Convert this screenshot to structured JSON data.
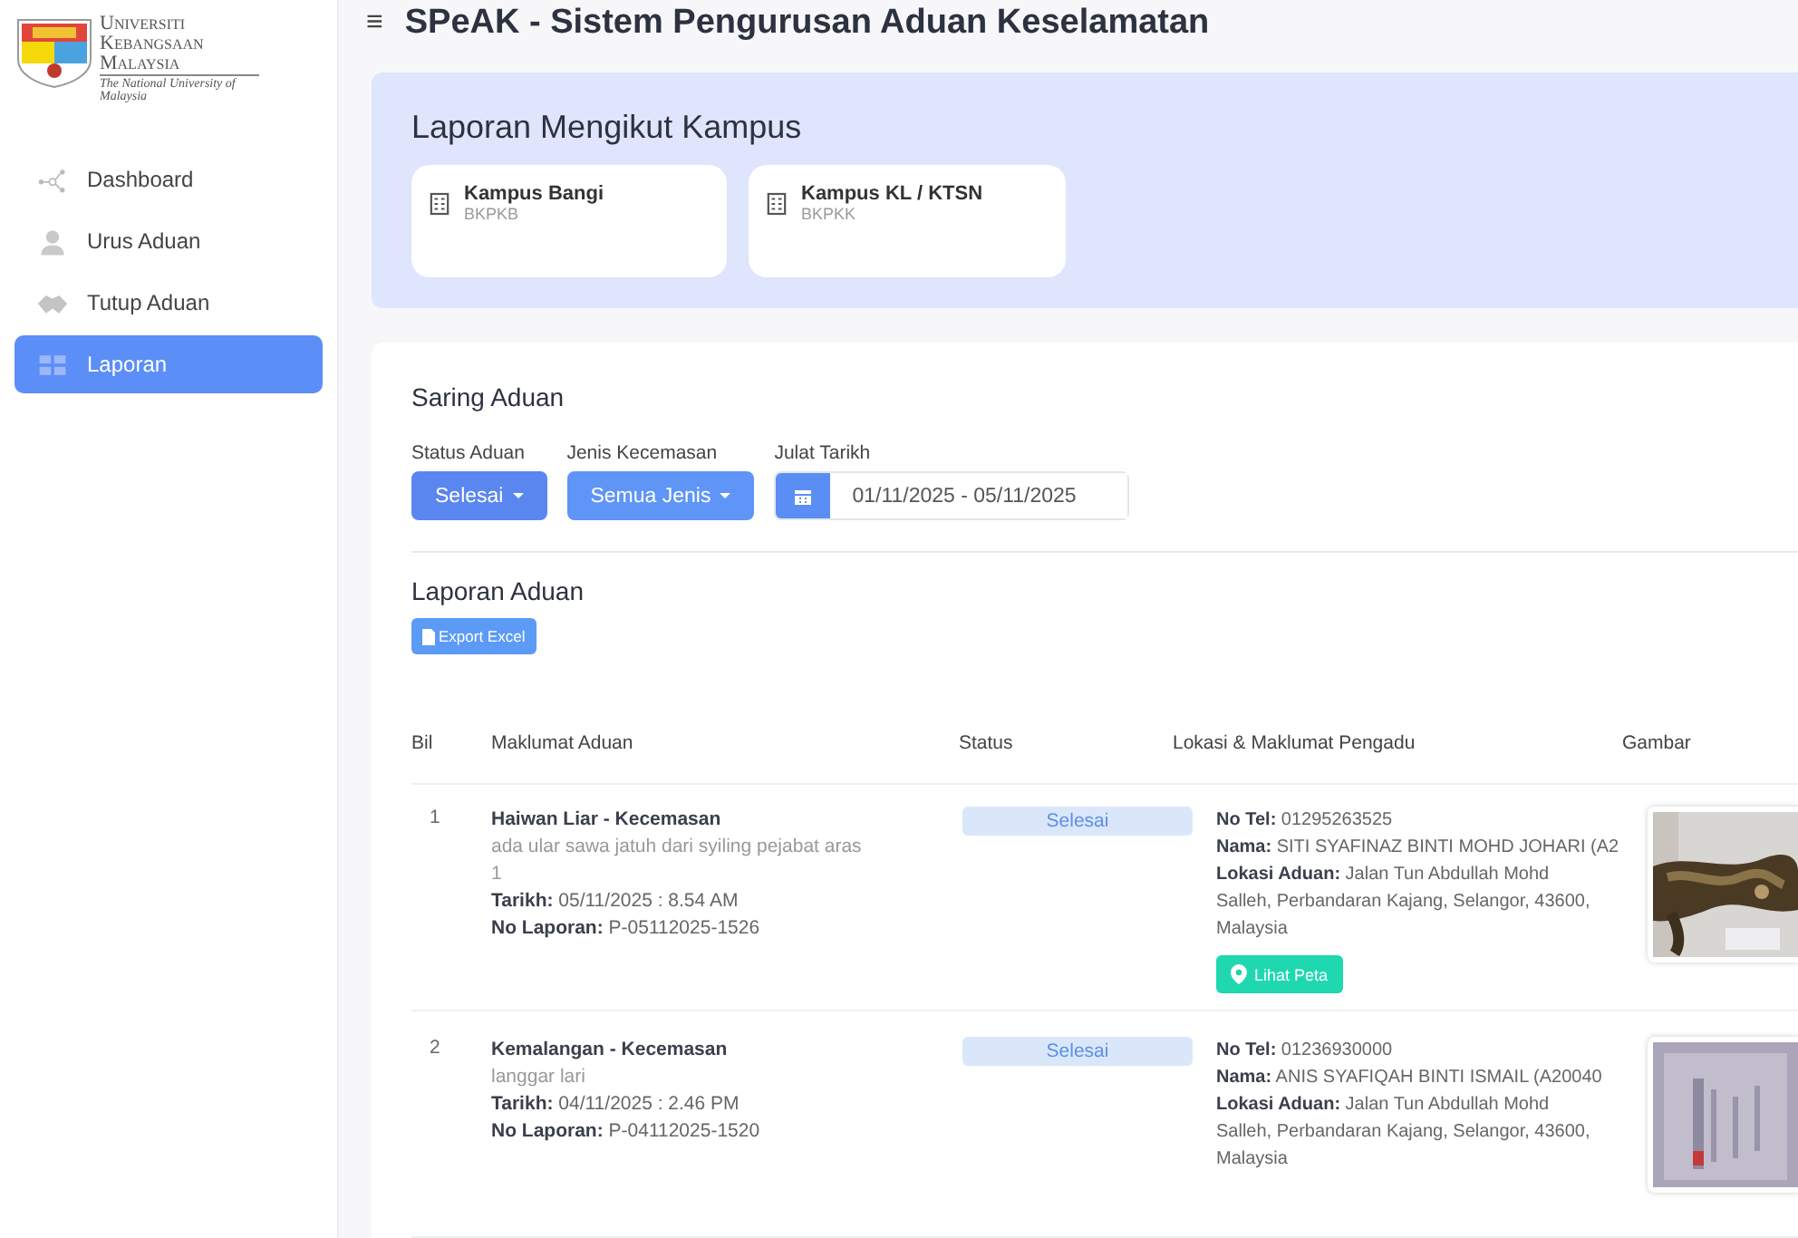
{
  "logo": {
    "name_lines": [
      "Universiti",
      "Kebangsaan",
      "Malaysia"
    ],
    "tagline": "The National University of Malaysia"
  },
  "sidebar": {
    "items": [
      {
        "label": "Dashboard",
        "selected": false
      },
      {
        "label": "Urus Aduan",
        "selected": false
      },
      {
        "label": "Tutup Aduan",
        "selected": false
      },
      {
        "label": "Laporan",
        "selected": true
      }
    ]
  },
  "header": {
    "menu_icon": "≡",
    "title": "SPeAK - Sistem Pengurusan Aduan Keselamatan"
  },
  "campus_panel": {
    "title": "Laporan Mengikut Kampus",
    "campuses": [
      {
        "name": "Kampus Bangi",
        "code": "BKPKB"
      },
      {
        "name": "Kampus KL / KTSN",
        "code": "BKPKK"
      }
    ]
  },
  "filter": {
    "title": "Saring Aduan",
    "status": {
      "label": "Status Aduan",
      "value": "Selesai"
    },
    "type": {
      "label": "Jenis Kecemasan",
      "value": "Semua Jenis"
    },
    "date": {
      "label": "Julat Tarikh",
      "value": "01/11/2025 - 05/11/2025"
    }
  },
  "report": {
    "title": "Laporan Aduan",
    "export_button": "Export Excel"
  },
  "table": {
    "columns": [
      "Bil",
      "Maklumat Aduan",
      "Status",
      "Lokasi & Maklumat Pengadu",
      "Gambar"
    ],
    "rows": [
      {
        "no": "1",
        "title": "Haiwan Liar - Kecemasan",
        "description": "ada ular sawa jatuh dari syiling pejabat aras 1",
        "date_label": "Tarikh:",
        "date": "05/11/2025 : 8.54 AM",
        "report_label": "No Laporan:",
        "report_no": "P-05112025-1526",
        "status": "Selesai",
        "tel_label": "No Tel:",
        "tel": "01295263525",
        "name_label": "Nama:",
        "name": "SITI SYAFINAZ BINTI MOHD JOHARI (A2",
        "location_label": "Lokasi Aduan:",
        "location": "Jalan Tun Abdullah Mohd Salleh, Perbandaran Kajang, Selangor, 43600, Malaysia",
        "map_button": "Lihat Peta"
      },
      {
        "no": "2",
        "title": "Kemalangan - Kecemasan",
        "description": "langgar lari",
        "date_label": "Tarikh:",
        "date": "04/11/2025 : 2.46 PM",
        "report_label": "No Laporan:",
        "report_no": "P-04112025-1520",
        "status": "Selesai",
        "tel_label": "No Tel:",
        "tel": "01236930000",
        "name_label": "Nama:",
        "name": "ANIS SYAFIQAH BINTI ISMAIL (A20040",
        "location_label": "Lokasi Aduan:",
        "location": "Jalan Tun Abdullah Mohd Salleh, Perbandaran Kajang, Selangor, 43600, Malaysia"
      }
    ]
  }
}
